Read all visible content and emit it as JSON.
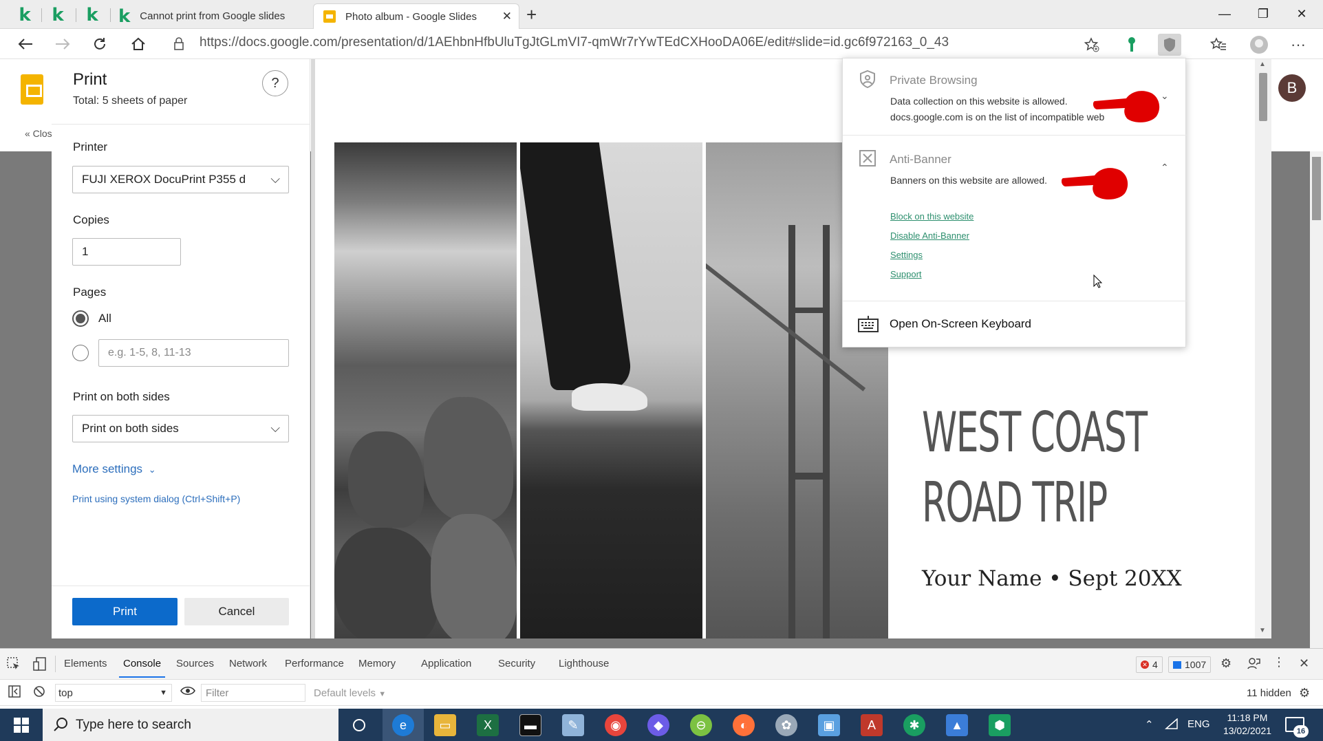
{
  "browser": {
    "tabs": [
      {
        "icon": "kaspersky-k-icon",
        "label": "k"
      },
      {
        "icon": "kaspersky-k-icon",
        "label": "k"
      },
      {
        "icon": "kaspersky-k-icon",
        "label": "k"
      },
      {
        "icon": "kaspersky-k-icon",
        "label": "Cannot print from Google slides"
      },
      {
        "icon": "google-slides-icon",
        "label": "Photo album - Google Slides",
        "active": true
      }
    ],
    "url": "https://docs.google.com/presentation/d/1AEhbnHfbUluTgJtGLmVI7-qmWr7rYwTEdCXHooDA06E/edit#slide=id.gc6f972163_0_43"
  },
  "docs": {
    "close_link": "« Clos",
    "avatar_letter": "B"
  },
  "print": {
    "title": "Print",
    "subtitle": "Total: 5 sheets of paper",
    "help": "?",
    "printer_label": "Printer",
    "printer_value": "FUJI XEROX DocuPrint P355 d",
    "copies_label": "Copies",
    "copies_value": "1",
    "pages_label": "Pages",
    "pages_all": "All",
    "pages_range_placeholder": "e.g. 1-5, 8, 11-13",
    "duplex_label": "Print on both sides",
    "duplex_value": "Print on both sides",
    "more_settings": "More settings",
    "system_dialog": "Print using system dialog (Ctrl+Shift+P)",
    "print_button": "Print",
    "cancel_button": "Cancel"
  },
  "slide": {
    "title_line1": "WEST COAST",
    "title_line2": "ROAD TRIP",
    "subtitle": "Your Name • Sept 20XX"
  },
  "kaspersky": {
    "private_title": "Private Browsing",
    "private_line1": "Data collection on this website is allowed.",
    "private_line2": "docs.google.com is on the list of incompatible web",
    "banner_title": "Anti-Banner",
    "banner_line1": "Banners on this website are allowed.",
    "links": [
      "Block on this website",
      "Disable Anti-Banner",
      "Settings",
      "Support"
    ],
    "keyboard": "Open On-Screen Keyboard"
  },
  "devtools": {
    "tabs": [
      "Elements",
      "Console",
      "Sources",
      "Network",
      "Performance",
      "Memory",
      "Application",
      "Security",
      "Lighthouse"
    ],
    "active_tab": "Console",
    "errors": "4",
    "messages": "1007",
    "context": "top",
    "filter_placeholder": "Filter",
    "levels": "Default levels",
    "hidden": "11 hidden"
  },
  "taskbar": {
    "search_placeholder": "Type here to search",
    "lang": "ENG",
    "time": "11:18 PM",
    "date": "13/02/2021",
    "notifications": "16"
  }
}
